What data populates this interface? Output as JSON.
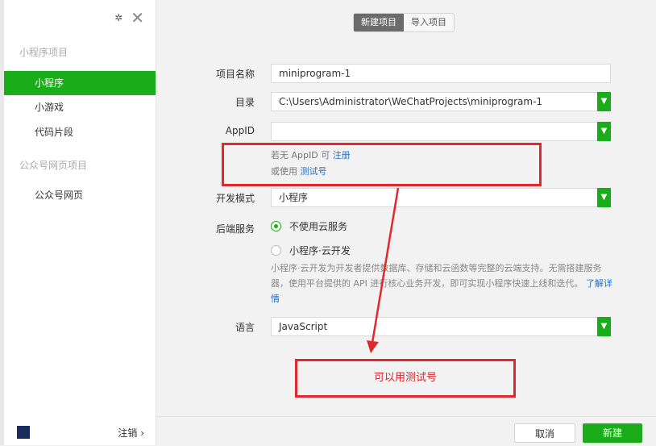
{
  "sidebar": {
    "mini_section": "小程序项目",
    "items": [
      {
        "label": "小程序"
      },
      {
        "label": "小游戏"
      },
      {
        "label": "代码片段"
      }
    ],
    "web_section": "公众号网页项目",
    "web_item": "公众号网页",
    "logout": "注销 ›"
  },
  "tabs": [
    "新建项目",
    "导入项目"
  ],
  "form": {
    "name_label": "项目名称",
    "name_value": "miniprogram-1",
    "dir_label": "目录",
    "dir_value": "C:\\Users\\Administrator\\WeChatProjects\\miniprogram-1",
    "appid_label": "AppID",
    "appid_value": "",
    "hint1_prefix": "若无 AppID 可",
    "hint1_link": "注册",
    "hint2_prefix": "或使用",
    "hint2_link": "测试号",
    "mode_label": "开发模式",
    "mode_value": "小程序",
    "backend_label": "后端服务",
    "backend_option1": "不使用云服务",
    "backend_option2": "小程序·云开发",
    "desc": "小程序·云开发为开发者提供数据库、存储和云函数等完整的云端支持。无需搭建服务器，使用平台提供的 API 进行核心业务开发，即可实现小程序快速上线和迭代。",
    "desc_link": "了解详情",
    "lang_label": "语言",
    "lang_value": "JavaScript"
  },
  "buttons": {
    "cancel": "取消",
    "create": "新建"
  },
  "annotation": {
    "text": "可以用测试号",
    "color": "#e0292e"
  },
  "colors": {
    "accent": "#1aad19",
    "link": "#1a6fd8"
  }
}
